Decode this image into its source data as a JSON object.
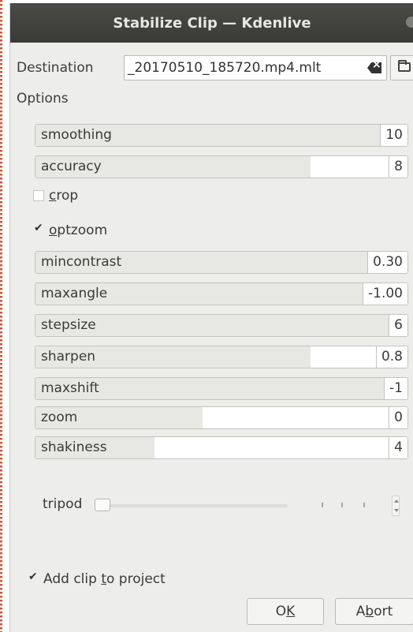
{
  "window": {
    "title": "Stabilize Clip — Kdenlive"
  },
  "destination": {
    "label": "Destination",
    "value": "_20170510_185720.mp4.mlt"
  },
  "options_label": "Options",
  "params_top": [
    {
      "name": "smoothing",
      "value": "10",
      "fill": 1.0
    },
    {
      "name": "accuracy",
      "value": "8",
      "fill": 0.74
    }
  ],
  "crop": {
    "label_first": "c",
    "label_rest": "rop",
    "checked": false
  },
  "optzoom": {
    "label_first": "o",
    "label_rest": "ptzoom",
    "checked": true
  },
  "params_bottom": [
    {
      "name": "mincontrast",
      "value": "0.30",
      "fill": 1.0
    },
    {
      "name": "maxangle",
      "value": "-1.00",
      "fill": 1.0
    },
    {
      "name": "stepsize",
      "value": "6",
      "fill": 1.0
    },
    {
      "name": "sharpen",
      "value": "0.8",
      "fill": 0.74
    },
    {
      "name": "maxshift",
      "value": "-1",
      "fill": 1.0
    },
    {
      "name": "zoom",
      "value": "0",
      "fill": 0.45
    },
    {
      "name": "shakiness",
      "value": "4",
      "fill": 0.32
    }
  ],
  "tripod": {
    "label": "tripod",
    "value": 0
  },
  "add_clip": {
    "before": "Add clip ",
    "underlined": "t",
    "after": "o project",
    "checked": true
  },
  "buttons": {
    "ok_first": "O",
    "ok_underlined": "K",
    "abort_first": "A",
    "abort_underlined": "b",
    "abort_rest": "ort"
  }
}
